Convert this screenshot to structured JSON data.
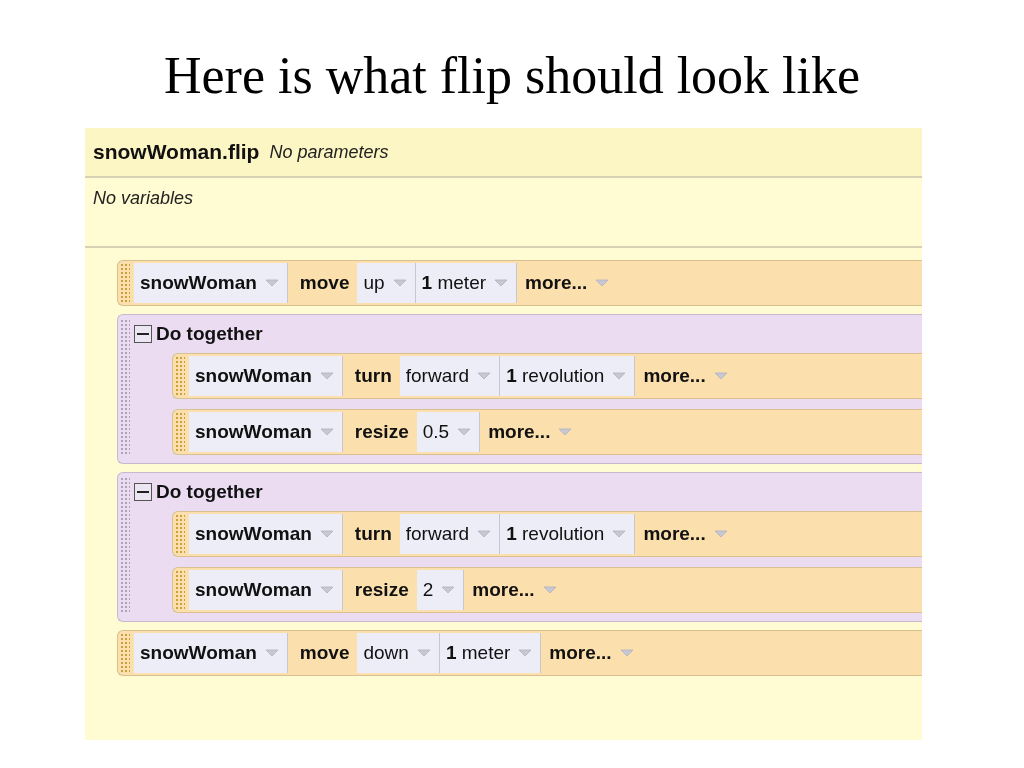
{
  "slide": {
    "title": "Here is what flip should look like"
  },
  "editor": {
    "method": "snowWoman.flip",
    "parameters": "No parameters",
    "variables": "No variables",
    "statements": [
      {
        "kind": "statement",
        "parts": [
          {
            "kind": "object",
            "text": "snowWoman"
          },
          {
            "kind": "verb",
            "text": "move"
          },
          {
            "kind": "param",
            "text": "up"
          },
          {
            "kind": "param",
            "text": "**1** meter"
          },
          {
            "kind": "more",
            "text": "more..."
          }
        ]
      },
      {
        "kind": "group",
        "title": "Do together",
        "expanded": true,
        "children": [
          {
            "kind": "statement",
            "parts": [
              {
                "kind": "object",
                "text": "snowWoman"
              },
              {
                "kind": "verb",
                "text": "turn"
              },
              {
                "kind": "param",
                "text": "forward"
              },
              {
                "kind": "param",
                "text": "**1** revolution"
              },
              {
                "kind": "more",
                "text": "more..."
              }
            ]
          },
          {
            "kind": "statement",
            "parts": [
              {
                "kind": "object",
                "text": "snowWoman"
              },
              {
                "kind": "verb",
                "text": "resize"
              },
              {
                "kind": "param",
                "text": "0.5"
              },
              {
                "kind": "more",
                "text": "more..."
              }
            ]
          }
        ]
      },
      {
        "kind": "group",
        "title": "Do together",
        "expanded": true,
        "children": [
          {
            "kind": "statement",
            "parts": [
              {
                "kind": "object",
                "text": "snowWoman"
              },
              {
                "kind": "verb",
                "text": "turn"
              },
              {
                "kind": "param",
                "text": "forward"
              },
              {
                "kind": "param",
                "text": "**1** revolution"
              },
              {
                "kind": "more",
                "text": "more..."
              }
            ]
          },
          {
            "kind": "statement",
            "parts": [
              {
                "kind": "object",
                "text": "snowWoman"
              },
              {
                "kind": "verb",
                "text": "resize"
              },
              {
                "kind": "param",
                "text": "2"
              },
              {
                "kind": "more",
                "text": "more..."
              }
            ]
          }
        ]
      },
      {
        "kind": "statement",
        "parts": [
          {
            "kind": "object",
            "text": "snowWoman"
          },
          {
            "kind": "verb",
            "text": "move"
          },
          {
            "kind": "param",
            "text": "down"
          },
          {
            "kind": "param",
            "text": "**1** meter"
          },
          {
            "kind": "more",
            "text": "more..."
          }
        ]
      }
    ]
  }
}
